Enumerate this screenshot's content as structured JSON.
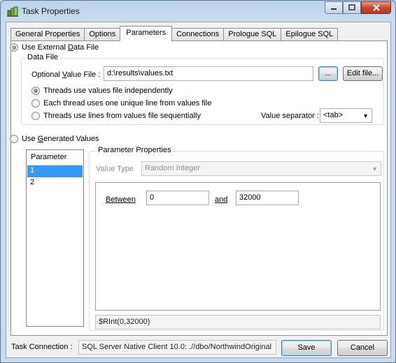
{
  "window": {
    "title": "Task Properties",
    "icon": "task-properties-icon",
    "caption_buttons": [
      "minimize",
      "maximize",
      "close"
    ]
  },
  "tabs": [
    {
      "label": "General Properties",
      "active": false
    },
    {
      "label": "Options",
      "active": false
    },
    {
      "label": "Parameters",
      "active": true
    },
    {
      "label": "Connections",
      "active": false
    },
    {
      "label": "Prologue SQL",
      "active": false
    },
    {
      "label": "Epilogue SQL",
      "active": false
    }
  ],
  "external": {
    "radio_label_pre": "Use External ",
    "radio_label_accel": "D",
    "radio_label_post": "ata File",
    "selected": true,
    "group_title": "Data File",
    "file_label_pre": "Optional ",
    "file_label_accel": "V",
    "file_label_post": "alue File :",
    "file_value": "d:\\results\\values.txt",
    "browse_label": "...",
    "edit_label": "Edit file...",
    "mode_options": [
      {
        "label": "Threads use values file independently",
        "selected": true
      },
      {
        "label": "Each thread uses one unique line from values file",
        "selected": false
      },
      {
        "label": "Threads use lines from values file sequentially",
        "selected": false
      }
    ],
    "separator_label": "Value separator :",
    "separator_value": "<tab>"
  },
  "generated": {
    "radio_label_pre": "Use ",
    "radio_label_accel": "G",
    "radio_label_post": "enerated Values",
    "selected": false,
    "list_header": "Parameter",
    "parameters": [
      {
        "label": "1",
        "selected": true
      },
      {
        "label": "2",
        "selected": false
      }
    ],
    "properties_title": "Parameter Properties",
    "value_type_label": "Value Type",
    "value_type_value": "Random Integer",
    "between_label": "Between",
    "between_value": "0",
    "and_label": "and",
    "and_value": "32000",
    "expression": "$RInt(0,32000)"
  },
  "footer": {
    "connection_label": "Task Connection :",
    "connection_value": "SQL Server Native Client 10.0: .//dbo/NorthwindOriginal",
    "save_label": "Save",
    "cancel_label": "Cancel"
  },
  "colors": {
    "selection": "#3399ff",
    "radio_checked": "#2c8a1c",
    "close_button": "#c8462b"
  }
}
